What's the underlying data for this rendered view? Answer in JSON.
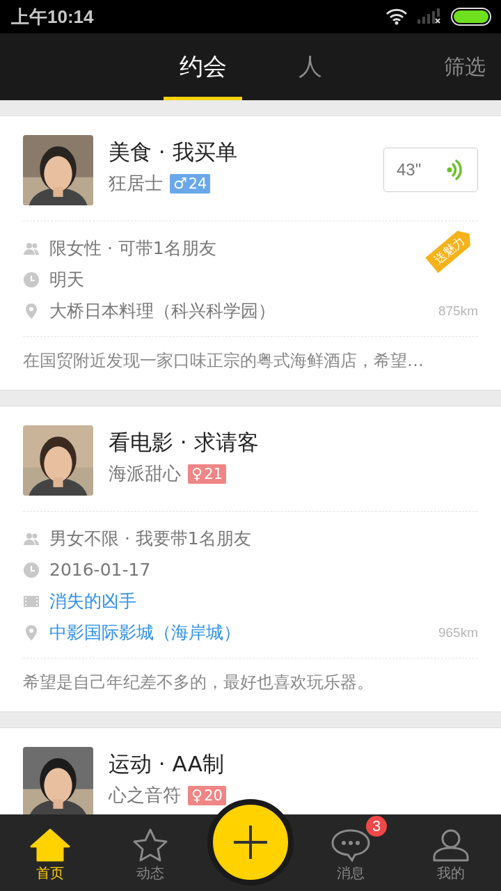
{
  "status_bar": {
    "time": "上午10:14"
  },
  "tabs": [
    {
      "label": "约会",
      "selected": true
    },
    {
      "label": "人",
      "selected": false
    }
  ],
  "filter": "筛选",
  "cards": [
    {
      "title": "美食 · 我买单",
      "name": "狂居士",
      "gender": "♂",
      "age": "24",
      "voice": "43\"",
      "tag": "送魅力",
      "details": [
        {
          "kind": "people",
          "text": "限女性 · 可带1名朋友",
          "link": false
        },
        {
          "kind": "time",
          "text": "明天",
          "link": false
        },
        {
          "kind": "place",
          "text": "大桥日本料理（科兴科学园）",
          "link": false
        }
      ],
      "distance": "875km",
      "description": "在国贸附近发现一家口味正宗的粤式海鲜酒店，希望…"
    },
    {
      "title": "看电影 · 求请客",
      "name": "海派甜心",
      "gender": "♀",
      "age": "21",
      "details": [
        {
          "kind": "people",
          "text": "男女不限 · 我要带1名朋友",
          "link": false
        },
        {
          "kind": "time",
          "text": "2016-01-17",
          "link": false
        },
        {
          "kind": "movie",
          "text": "消失的凶手",
          "link": true
        },
        {
          "kind": "place",
          "text": "中影国际影城（海岸城）",
          "link": true
        }
      ],
      "distance": "965km",
      "description": "希望是自己年纪差不多的，最好也喜欢玩乐器。"
    },
    {
      "title": "运动 · AA制",
      "name": "心之音符",
      "gender": "♀",
      "age": "20"
    }
  ],
  "nav": [
    {
      "kind": "home",
      "label": "首页",
      "selected": true
    },
    {
      "kind": "star",
      "label": "动态",
      "selected": false
    },
    {
      "kind": "add"
    },
    {
      "kind": "message",
      "label": "消息",
      "selected": false,
      "badge": "3"
    },
    {
      "kind": "person",
      "label": "我的",
      "selected": false
    }
  ]
}
